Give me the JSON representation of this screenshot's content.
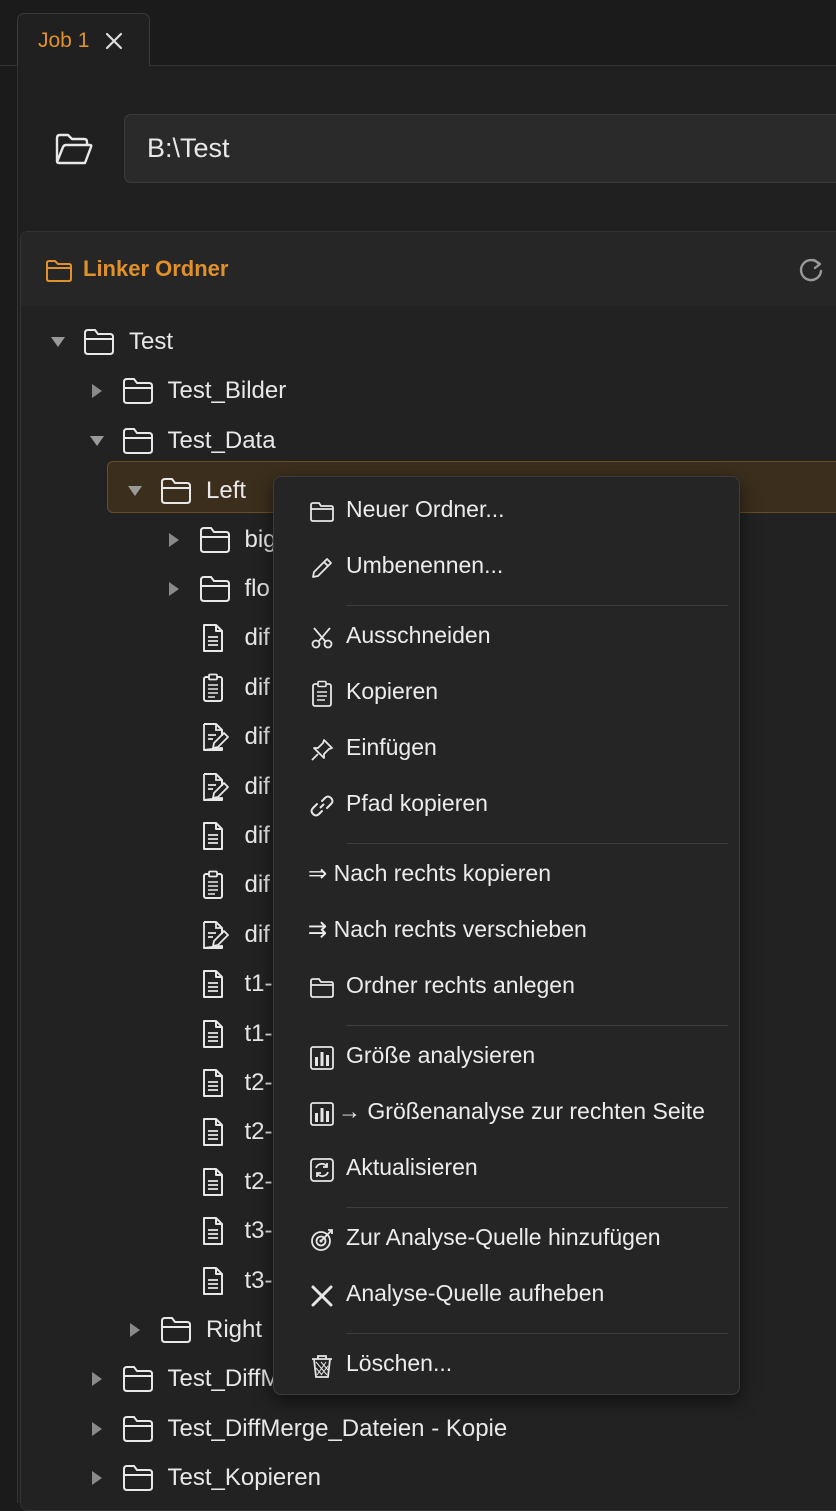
{
  "tab": {
    "label": "Job 1",
    "close_icon": "close-icon"
  },
  "path": {
    "value": "B:\\Test",
    "icon": "folder-open-icon"
  },
  "panel": {
    "title": "Linker Ordner",
    "refresh_icon": "refresh-icon"
  },
  "tree": [
    {
      "label": "Test",
      "type": "folder",
      "expanded": true,
      "level": 0
    },
    {
      "label": "Test_Bilder",
      "type": "folder",
      "expanded": false,
      "level": 1
    },
    {
      "label": "Test_Data",
      "type": "folder",
      "expanded": true,
      "level": 1
    },
    {
      "label": "Left",
      "type": "folder",
      "expanded": true,
      "level": 2,
      "selected": true
    },
    {
      "label": "big",
      "type": "folder",
      "expanded": false,
      "level": 3
    },
    {
      "label": "flo",
      "type": "folder",
      "expanded": false,
      "level": 3
    },
    {
      "label": "dif",
      "type": "file-text",
      "level": 3
    },
    {
      "label": "dif",
      "type": "file-clipboard",
      "level": 3
    },
    {
      "label": "dif",
      "type": "file-edit",
      "level": 3
    },
    {
      "label": "dif",
      "type": "file-edit",
      "level": 3
    },
    {
      "label": "dif",
      "type": "file-text",
      "level": 3
    },
    {
      "label": "dif",
      "type": "file-clipboard",
      "level": 3
    },
    {
      "label": "dif",
      "type": "file-edit",
      "level": 3
    },
    {
      "label": "t1-",
      "type": "file-text",
      "level": 3
    },
    {
      "label": "t1-",
      "type": "file-text",
      "level": 3
    },
    {
      "label": "t2-",
      "type": "file-text",
      "level": 3
    },
    {
      "label": "t2-",
      "type": "file-text",
      "level": 3
    },
    {
      "label": "t2-",
      "type": "file-text",
      "level": 3
    },
    {
      "label": "t3-",
      "type": "file-text",
      "level": 3
    },
    {
      "label": "t3-",
      "type": "file-text",
      "level": 3
    },
    {
      "label": "Right",
      "type": "folder",
      "expanded": false,
      "level": 2
    },
    {
      "label": "Test_DiffM",
      "type": "folder",
      "expanded": false,
      "level": 1
    },
    {
      "label": "Test_DiffMerge_Dateien - Kopie",
      "type": "folder",
      "expanded": false,
      "level": 1
    },
    {
      "label": "Test_Kopieren",
      "type": "folder",
      "expanded": false,
      "level": 1
    }
  ],
  "context_menu": {
    "items": [
      {
        "label": "Neuer Ordner...",
        "icon": "folder-icon"
      },
      {
        "label": "Umbenennen...",
        "icon": "pencil-icon"
      },
      {
        "sep": true
      },
      {
        "label": "Ausschneiden",
        "icon": "scissors-icon"
      },
      {
        "label": "Kopieren",
        "icon": "clipboard-icon"
      },
      {
        "label": "Einfügen",
        "icon": "pin-icon"
      },
      {
        "label": "Pfad kopieren",
        "icon": "link-icon"
      },
      {
        "sep": true
      },
      {
        "label": "⇒ Nach rechts kopieren",
        "icon": ""
      },
      {
        "label": "⇉ Nach rechts verschieben",
        "icon": ""
      },
      {
        "label": "Ordner rechts anlegen",
        "icon": "folder-icon"
      },
      {
        "sep": true
      },
      {
        "label": "Größe analysieren",
        "icon": "bar-chart-icon"
      },
      {
        "label": "→ Größenanalyse zur rechten Seite",
        "icon": "bar-chart-icon"
      },
      {
        "label": "Aktualisieren",
        "icon": "refresh-box-icon"
      },
      {
        "sep": true
      },
      {
        "label": "Zur Analyse-Quelle hinzufügen",
        "icon": "target-icon"
      },
      {
        "label": "Analyse-Quelle aufheben",
        "icon": "x-icon"
      },
      {
        "sep": true
      },
      {
        "label": "Löschen...",
        "icon": "trash-icon"
      }
    ]
  },
  "colors": {
    "accent": "#e0912a",
    "bg": "#202020",
    "menu_bg": "#252525",
    "selected_bg": "#3b2e1c"
  }
}
